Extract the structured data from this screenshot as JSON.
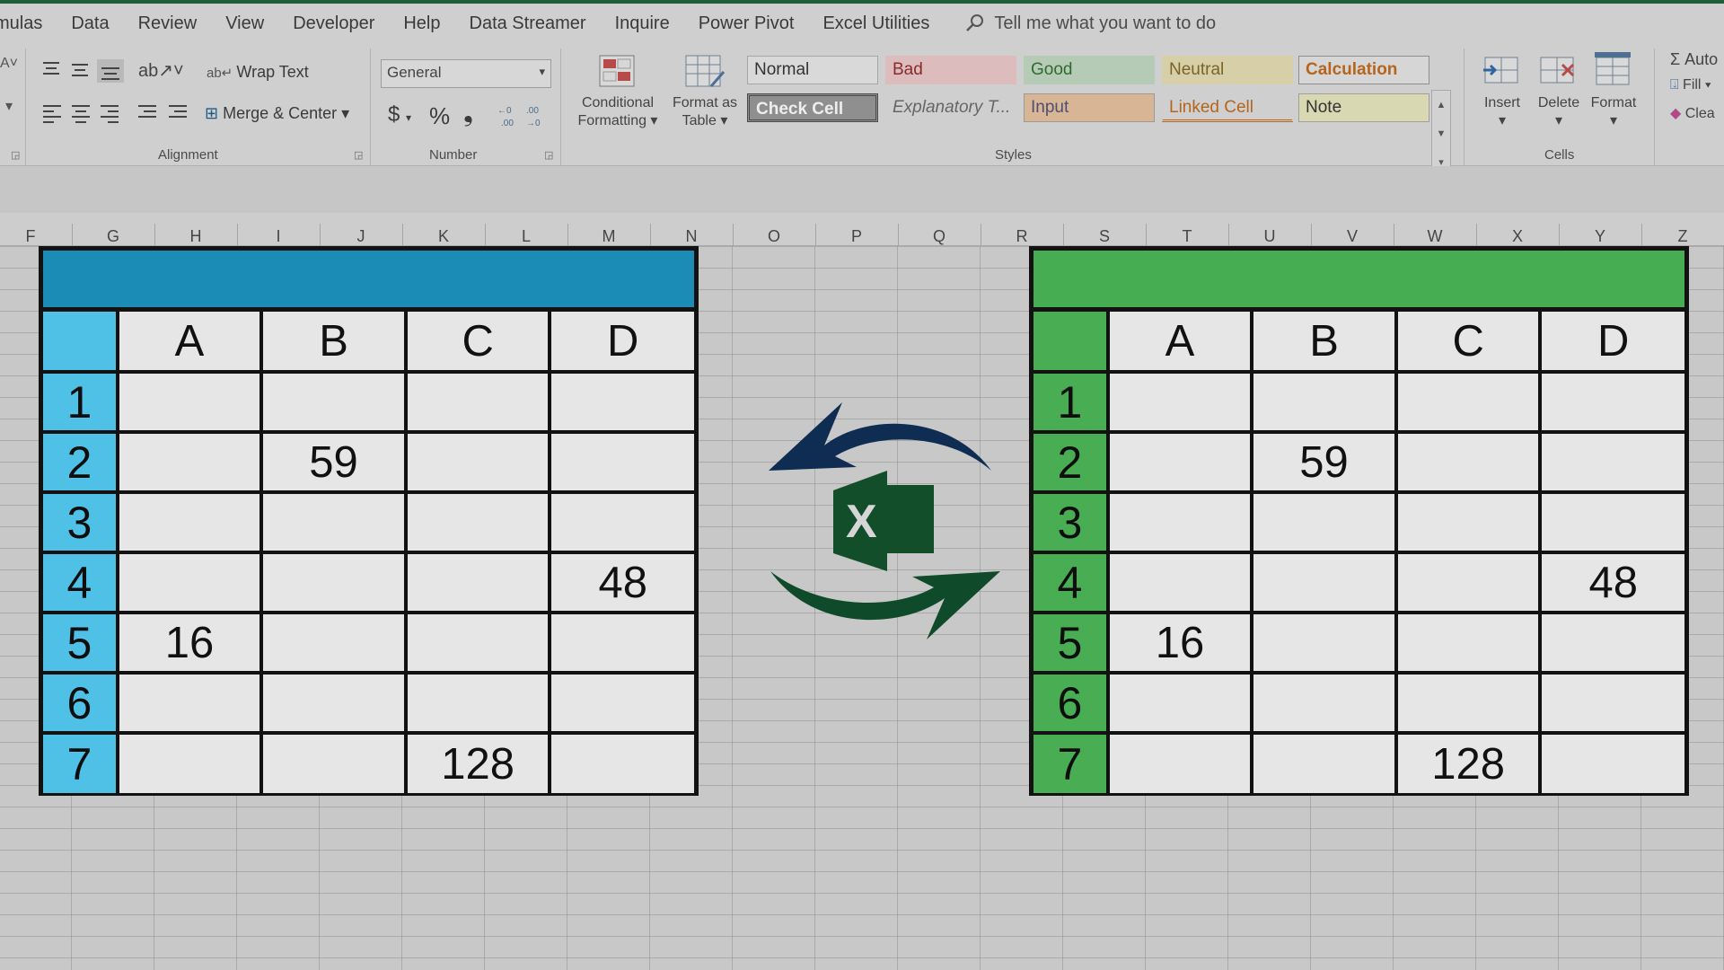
{
  "menu": {
    "items": [
      "mulas",
      "Data",
      "Review",
      "View",
      "Developer",
      "Help",
      "Data Streamer",
      "Inquire",
      "Power Pivot",
      "Excel Utilities"
    ],
    "tell_me": "Tell me what you want to do",
    "tell_me_icon": "lightbulb-search-icon"
  },
  "ribbon": {
    "alignment": {
      "wrap_text": "Wrap Text",
      "merge_center": "Merge & Center",
      "label": "Alignment"
    },
    "number": {
      "format_value": "General",
      "currency": "$",
      "percent": "%",
      "comma": "!",
      "label": "Number"
    },
    "styles": {
      "conditional_formatting": [
        "Conditional",
        "Formatting"
      ],
      "format_as_table": [
        "Format as",
        "Table"
      ],
      "cells": [
        {
          "label": "Normal",
          "bg": "#d9d9d9",
          "fg": "#333333",
          "border": "#a6a6a6"
        },
        {
          "label": "Bad",
          "bg": "#dcbcbc",
          "fg": "#8a2b2b",
          "border": "#dcbcbc"
        },
        {
          "label": "Good",
          "bg": "#b5cbb5",
          "fg": "#2f6b2f",
          "border": "#b5cbb5"
        },
        {
          "label": "Neutral",
          "bg": "#d7cfa7",
          "fg": "#7a6426",
          "border": "#d7cfa7"
        },
        {
          "label": "Calculation",
          "bg": "#d6d6d6",
          "fg": "#b5651d",
          "border": "#8e8e8e"
        },
        {
          "label": "Check Cell",
          "bg": "#8f8f8f",
          "fg": "#eeeeee",
          "border": "#4a4a4a"
        },
        {
          "label": "Explanatory T...",
          "bg": "#cfcfcf",
          "fg": "#666666",
          "border": "#cfcfcf"
        },
        {
          "label": "Input",
          "bg": "#d7b595",
          "fg": "#4f4f73",
          "border": "#9a9a9a"
        },
        {
          "label": "Linked Cell",
          "bg": "#cfcfcf",
          "fg": "#b5651d",
          "border": "#cfcfcf"
        },
        {
          "label": "Note",
          "bg": "#d8d8b2",
          "fg": "#333333",
          "border": "#a0a0a0"
        }
      ],
      "label": "Styles"
    },
    "cells": {
      "insert": "Insert",
      "delete": "Delete",
      "format": "Format",
      "label": "Cells"
    },
    "editing": {
      "autosum": "Auto",
      "fill": "Fill",
      "clear": "Clea"
    }
  },
  "column_headers": [
    "F",
    "G",
    "H",
    "I",
    "J",
    "K",
    "L",
    "M",
    "N",
    "O",
    "P",
    "Q",
    "R",
    "S",
    "T",
    "U",
    "V",
    "W",
    "X",
    "Y",
    "Z"
  ],
  "illustration": {
    "left_color": "#1b8cb5",
    "left_hdr_color": "#4fc0e6",
    "right_color": "#46ad52",
    "right_hdr_color": "#48ad53",
    "arrow_top_color": "#0f2d52",
    "arrow_bottom_color": "#0f4a2a",
    "logo_color": "#124e2a",
    "logo_letter": "X",
    "columns": [
      "A",
      "B",
      "C",
      "D"
    ],
    "rows": [
      {
        "n": "1",
        "cells": [
          "",
          "",
          "",
          ""
        ]
      },
      {
        "n": "2",
        "cells": [
          "",
          "59",
          "",
          ""
        ]
      },
      {
        "n": "3",
        "cells": [
          "",
          "",
          "",
          ""
        ]
      },
      {
        "n": "4",
        "cells": [
          "",
          "",
          "",
          "48"
        ]
      },
      {
        "n": "5",
        "cells": [
          "16",
          "",
          "",
          ""
        ]
      },
      {
        "n": "6",
        "cells": [
          "",
          "",
          "",
          ""
        ]
      },
      {
        "n": "7",
        "cells": [
          "",
          "",
          "128",
          ""
        ]
      }
    ]
  }
}
